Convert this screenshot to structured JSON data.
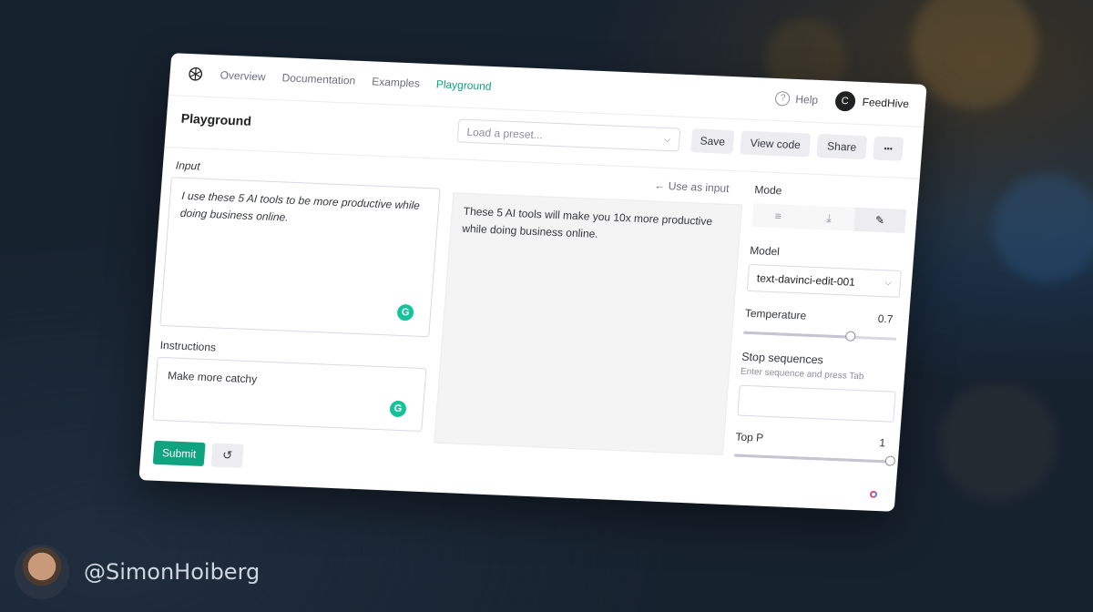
{
  "nav": {
    "links": [
      "Overview",
      "Documentation",
      "Examples",
      "Playground"
    ],
    "help": "Help",
    "user_initial": "C",
    "user_name": "FeedHive"
  },
  "toolbar": {
    "title": "Playground",
    "preset_placeholder": "Load a preset...",
    "save": "Save",
    "view_code": "View code",
    "share": "Share",
    "more": "•••"
  },
  "editor": {
    "input_label": "Input",
    "input_text": "I use these 5 AI tools to be more productive while doing business online.",
    "instructions_label": "Instructions",
    "instructions_text": "Make more catchy",
    "use_as_input": "← Use as input",
    "output_text": "These 5 AI tools will make you 10x more productive while doing business online.",
    "submit": "Submit"
  },
  "settings": {
    "mode_label": "Mode",
    "model_label": "Model",
    "model_value": "text-davinci-edit-001",
    "temperature_label": "Temperature",
    "temperature_value": "0.7",
    "temperature": 0.7,
    "stop_label": "Stop sequences",
    "stop_hint": "Enter sequence and press Tab",
    "top_p_label": "Top P",
    "top_p_value": "1",
    "top_p": 1
  },
  "footer": {
    "handle": "@SimonHoiberg"
  },
  "colors": {
    "accent": "#10a37f",
    "background": "#17222f"
  }
}
